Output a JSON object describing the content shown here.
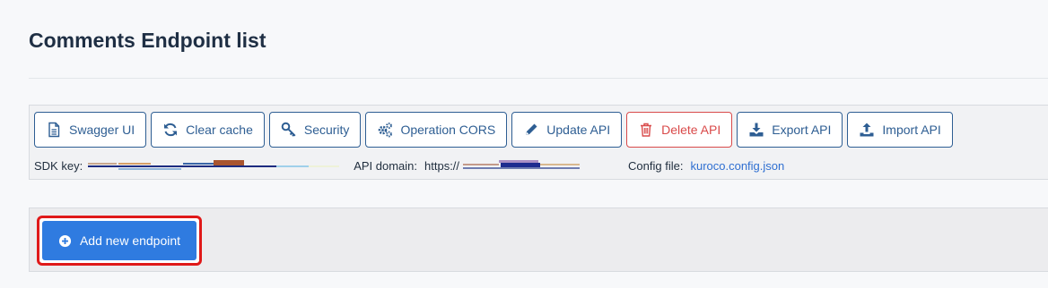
{
  "page": {
    "title": "Comments Endpoint list"
  },
  "toolbar": {
    "buttons": [
      {
        "label": "Swagger UI",
        "icon": "file-icon"
      },
      {
        "label": "Clear cache",
        "icon": "refresh-icon"
      },
      {
        "label": "Security",
        "icon": "key-icon"
      },
      {
        "label": "Operation CORS",
        "icon": "gears-icon"
      },
      {
        "label": "Update API",
        "icon": "pencil-icon"
      },
      {
        "label": "Delete API",
        "icon": "trash-icon"
      },
      {
        "label": "Export API",
        "icon": "download-icon"
      },
      {
        "label": "Import API",
        "icon": "upload-icon"
      }
    ]
  },
  "info": {
    "sdk_key_label": "SDK key:",
    "api_domain_label": "API domain:",
    "api_domain_value": "https://",
    "config_file_label": "Config file:",
    "config_file_value": "kuroco.config.json"
  },
  "actions": {
    "add_endpoint_label": "Add new endpoint"
  },
  "colors": {
    "primary": "#2e5e93",
    "danger": "#d94a4a",
    "accent_button": "#2f7be0",
    "highlight": "#e01919",
    "link": "#2f6fd1"
  }
}
